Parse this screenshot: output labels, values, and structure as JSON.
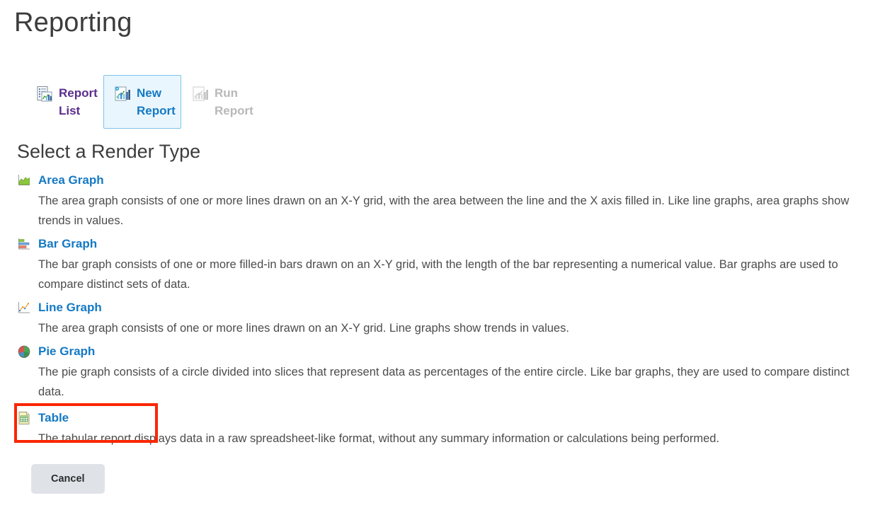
{
  "page": {
    "title": "Reporting",
    "section_heading": "Select a Render Type"
  },
  "tabs": [
    {
      "label": "Report List",
      "icon": "report-list-icon",
      "state": "normal",
      "color": "#5b2d8e"
    },
    {
      "label": "New Report",
      "icon": "new-report-icon",
      "state": "selected",
      "color": "#1479c4"
    },
    {
      "label": "Run Report",
      "icon": "run-report-icon",
      "state": "disabled",
      "color": "#b8b8b8"
    }
  ],
  "render_types": [
    {
      "name": "Area Graph",
      "icon": "area-graph-icon",
      "description": "The area graph consists of one or more lines drawn on an X-Y grid, with the area between the line and the X axis filled in. Like line graphs, area graphs show trends in values."
    },
    {
      "name": "Bar Graph",
      "icon": "bar-graph-icon",
      "description": "The bar graph consists of one or more filled-in bars drawn on an X-Y grid, with the length of the bar representing a numerical value. Bar graphs are used to compare distinct sets of data."
    },
    {
      "name": "Line Graph",
      "icon": "line-graph-icon",
      "description": "The area graph consists of one or more lines drawn on an X-Y grid. Line graphs show trends in values."
    },
    {
      "name": "Pie Graph",
      "icon": "pie-graph-icon",
      "description": "The pie graph consists of a circle divided into slices that represent data as percentages of the entire circle. Like bar graphs, they are used to compare distinct data."
    },
    {
      "name": "Table",
      "icon": "table-icon",
      "description": "The tabular report displays data in a raw spreadsheet-like format, without any summary information or calculations being performed."
    }
  ],
  "footer": {
    "cancel_label": "Cancel"
  },
  "annotation": {
    "color": "#fa2600",
    "target": "Table"
  }
}
